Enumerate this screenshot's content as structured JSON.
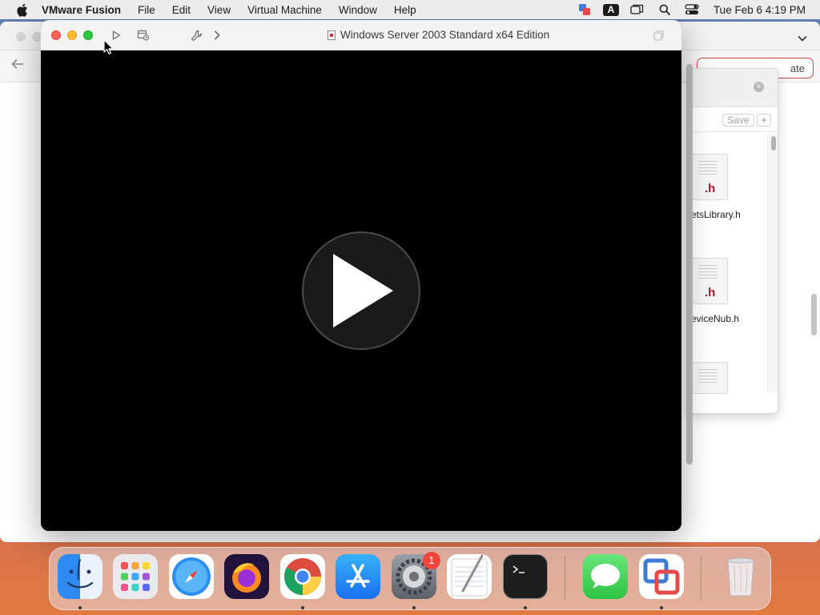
{
  "menubar": {
    "app_name": "VMware Fusion",
    "items": [
      "File",
      "Edit",
      "View",
      "Virtual Machine",
      "Window",
      "Help"
    ],
    "input_indicator": "A",
    "clock": "Tue Feb 6  4:19 PM"
  },
  "vm_window": {
    "title": "Windows Server 2003 Standard x64 Edition"
  },
  "background_window": {
    "update_button": "ate"
  },
  "panel": {
    "save_label": "Save",
    "add_label": "+",
    "files": [
      {
        "ext": ".h",
        "label": "etsLibrary.h"
      },
      {
        "ext": ".h",
        "label": "eviceNub.h"
      }
    ]
  },
  "dock": {
    "apps": [
      "Finder",
      "Launchpad",
      "Safari",
      "Firefox",
      "Google Chrome",
      "App Store",
      "System Preferences",
      "TextEdit",
      "Terminal",
      "Messages",
      "VMware Fusion",
      "Trash"
    ],
    "system_prefs_badge": "1"
  }
}
